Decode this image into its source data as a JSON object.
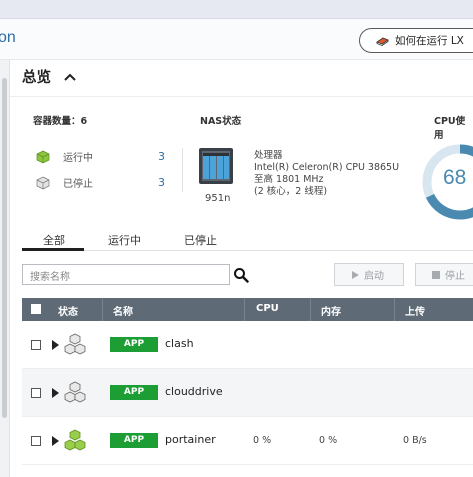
{
  "header": {
    "brand_text": "on",
    "howto_label": "如何在运行 LX"
  },
  "overview": {
    "section_title": "总览",
    "container_count_label": "容器数量：6",
    "running_label": "运行中",
    "running_count": "3",
    "stopped_label": "已停止",
    "stopped_count": "3",
    "nas_status_label": "NAS状态",
    "nas_name": "951n",
    "processor_lines": [
      "处理器",
      "Intel(R) Celeron(R) CPU 3865U",
      "至高 1801 MHz",
      "(2 核心，2 线程)"
    ],
    "cpu_label": "CPU使用",
    "cpu_value": "68"
  },
  "tabs": [
    {
      "label": "全部",
      "active": true
    },
    {
      "label": "运行中",
      "active": false
    },
    {
      "label": "已停止",
      "active": false
    }
  ],
  "toolbar": {
    "search_placeholder": "搜索名称",
    "start_label": "启动",
    "stop_label": "停止"
  },
  "table": {
    "columns": [
      "状态",
      "名称",
      "CPU",
      "内存",
      "上传"
    ],
    "rows": [
      {
        "type": "APP",
        "name": "clash",
        "cpu": "",
        "memory": "",
        "upload": "",
        "running": false
      },
      {
        "type": "APP",
        "name": "clouddrive",
        "cpu": "",
        "memory": "",
        "upload": "",
        "running": false
      },
      {
        "type": "APP",
        "name": "portainer",
        "cpu": "0 %",
        "memory": "0 %",
        "upload": "0 B/s",
        "running": true
      }
    ]
  },
  "colors": {
    "accent": "#2f6ea5",
    "app_tag": "#1c9e35",
    "grid_header": "#5e6a75",
    "gauge_ring": "#4a8ab0"
  }
}
